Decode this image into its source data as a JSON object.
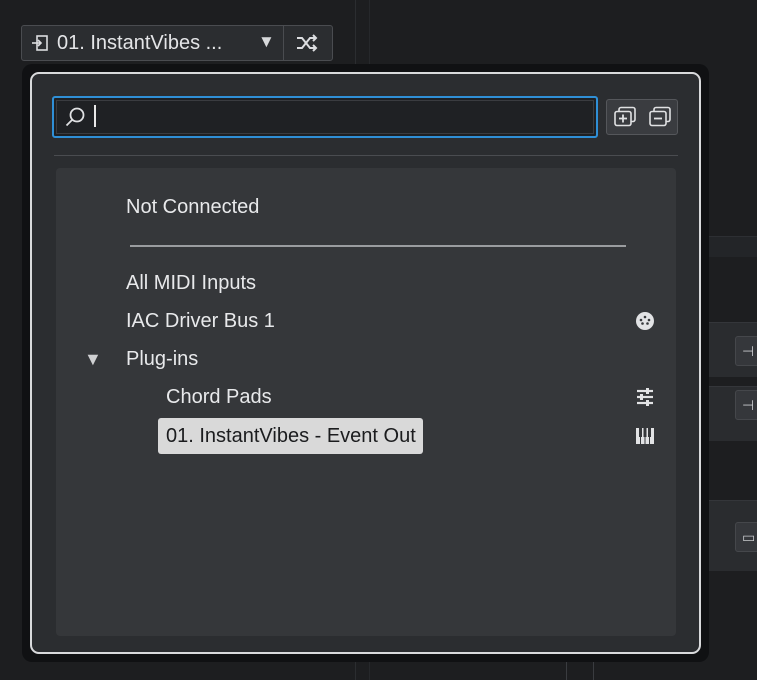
{
  "selector": {
    "label": "01. InstantVibes ...",
    "route_icon": "input-route-icon",
    "caret_glyph": "▼",
    "shuffle_icon": "shuffle-icon"
  },
  "search": {
    "value": "",
    "placeholder": ""
  },
  "buttons": {
    "expand_all_icon": "expand-all-icon",
    "collapse_all_icon": "collapse-all-icon"
  },
  "list": {
    "not_connected": "Not Connected",
    "all_midi_inputs": "All MIDI Inputs",
    "iac_driver_bus": "IAC Driver Bus 1",
    "plugins": "Plug-ins",
    "plugins_caret": "▼",
    "chord_pads": "Chord Pads",
    "selected_item": "01. InstantVibes - Event Out"
  },
  "colors": {
    "accent_focus": "#2f8fd6",
    "selection_bg": "#d9d9d9"
  }
}
